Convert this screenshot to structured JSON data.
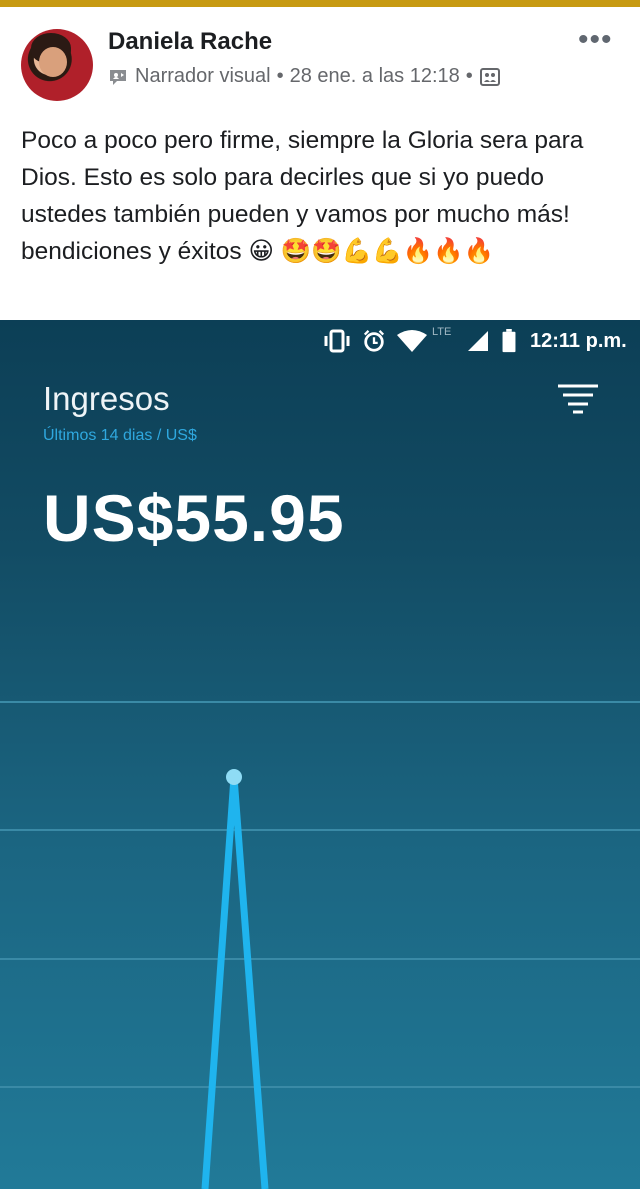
{
  "post": {
    "author": "Daniela Rache",
    "source": "Narrador visual",
    "separator": "•",
    "date": "28 ene. a las 12:18",
    "more": "•••",
    "text": "Poco a poco pero firme, siempre la Gloria sera para Dios. Esto es solo para decirles que si yo puedo ustedes también pueden y vamos por mucho más! bendiciones y éxitos 😀 🤩🤩💪💪🔥🔥🔥"
  },
  "screenshot": {
    "status_time": "12:11 p.m.",
    "network": "LTE",
    "title": "Ingresos",
    "subtitle": "Últimos 14 dias / US$",
    "amount": "US$55.95"
  },
  "colors": {
    "accent": "#c79a12",
    "chart_line": "#1fb4ee",
    "chart_point": "#8fdcf5"
  },
  "chart_data": {
    "type": "line",
    "title": "Ingresos",
    "xlabel": "",
    "ylabel": "",
    "grid": true,
    "series": [
      {
        "values": [
          0,
          55.95,
          0
        ]
      }
    ]
  }
}
